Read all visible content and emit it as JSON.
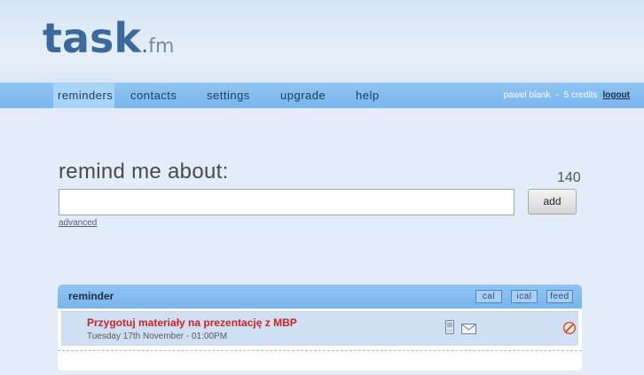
{
  "brand": {
    "logo_main": "task",
    "logo_dot": ".",
    "logo_tld": "fm"
  },
  "nav": {
    "items": [
      {
        "label": "reminders",
        "active": true
      },
      {
        "label": "contacts"
      },
      {
        "label": "settings"
      },
      {
        "label": "upgrade"
      },
      {
        "label": "help"
      }
    ]
  },
  "user": {
    "name": "pawel blank",
    "credits": "5 credits",
    "logout": "logout",
    "separator": "-"
  },
  "form": {
    "label": "remind me about:",
    "char_count": "140",
    "input_value": "",
    "add_label": "add",
    "advanced_label": "advanced"
  },
  "panel": {
    "title": "reminder",
    "buttons": [
      "cal",
      "ical",
      "feed"
    ],
    "reminders": [
      {
        "title": "Przygotuj materiały na prezentację z MBP",
        "date": "Tuesday 17th November - 01:00PM"
      }
    ]
  },
  "colors": {
    "accent": "#7ab6ec",
    "reminder_title": "#cc2222",
    "logo": "#3a6a9c",
    "delete": "#e0401a"
  }
}
